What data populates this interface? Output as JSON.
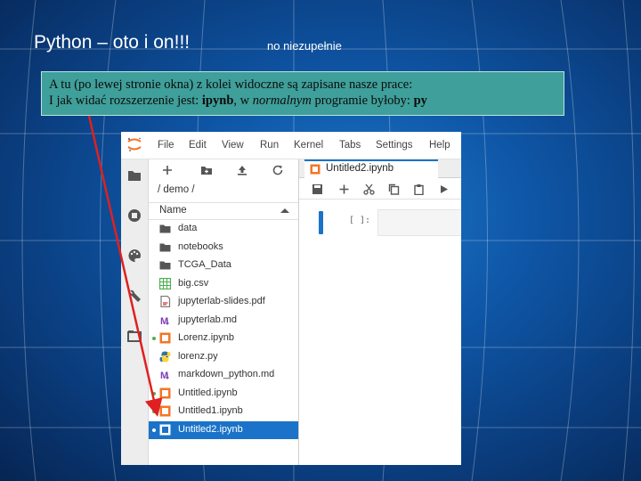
{
  "slide": {
    "title": "Python – oto i on!!!",
    "subtitle": "no niezupełnie"
  },
  "note": {
    "line1": "A tu (po lewej stronie okna) z kolei widoczne są zapisane nasze prace:",
    "line2_prefix": "I jak widać rozszerzenie jest: ",
    "ext_ipynb": "ipynb",
    "line2_mid": ", w ",
    "normal_word": "normalnym",
    "line2_mid2": " programie byłoby: ",
    "ext_py": "py"
  },
  "jupyter": {
    "logo_icon": "jupyter-logo-icon",
    "menu": [
      "File",
      "Edit",
      "View",
      "Run",
      "Kernel",
      "Tabs",
      "Settings",
      "Help"
    ],
    "left_sidebar_icons": [
      "folder-icon",
      "running-icon",
      "palette-icon",
      "wrench-icon",
      "tabs-icon"
    ],
    "filebrowser": {
      "toolbar_icons": [
        "new-launcher-icon",
        "new-folder-icon",
        "upload-icon",
        "refresh-icon"
      ],
      "breadcrumb": "/ demo /",
      "column_header": "Name",
      "files": [
        {
          "name": "data",
          "icon": "folder-icon",
          "running": false,
          "selected": false
        },
        {
          "name": "notebooks",
          "icon": "folder-icon",
          "running": false,
          "selected": false
        },
        {
          "name": "TCGA_Data",
          "icon": "folder-icon",
          "running": false,
          "selected": false
        },
        {
          "name": "big.csv",
          "icon": "spreadsheet-icon",
          "running": false,
          "selected": false
        },
        {
          "name": "jupyterlab-slides.pdf",
          "icon": "pdf-icon",
          "running": false,
          "selected": false
        },
        {
          "name": "jupyterlab.md",
          "icon": "markdown-icon",
          "running": false,
          "selected": false
        },
        {
          "name": "Lorenz.ipynb",
          "icon": "notebook-icon",
          "running": true,
          "selected": false
        },
        {
          "name": "lorenz.py",
          "icon": "python-icon",
          "running": false,
          "selected": false
        },
        {
          "name": "markdown_python.md",
          "icon": "markdown-icon",
          "running": false,
          "selected": false
        },
        {
          "name": "Untitled.ipynb",
          "icon": "notebook-icon",
          "running": true,
          "selected": false
        },
        {
          "name": "Untitled1.ipynb",
          "icon": "notebook-icon",
          "running": true,
          "selected": false
        },
        {
          "name": "Untitled2.ipynb",
          "icon": "notebook-icon",
          "running": true,
          "selected": true
        }
      ]
    },
    "notebook": {
      "tab_label": "Untitled2.ipynb",
      "toolbar_icons": [
        "save-icon",
        "add-cell-icon",
        "cut-icon",
        "copy-icon",
        "paste-icon",
        "run-icon"
      ],
      "cell_prompt": "[ ]:"
    }
  },
  "colors": {
    "accent": "#1a73c8",
    "note_background": "#3f9f9a",
    "arrow": "#e02020",
    "notebook_icon": "#f37626",
    "running_dot": "#4caf50"
  }
}
